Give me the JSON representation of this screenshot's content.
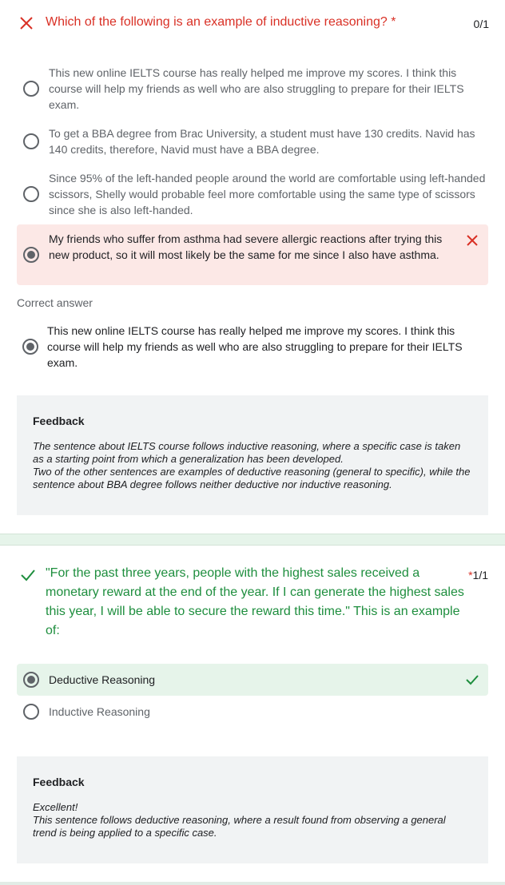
{
  "question1": {
    "title": "Which of the following is an example of inductive reasoning?",
    "required_mark": "*",
    "score": "0/1",
    "options": [
      {
        "text": "This new online IELTS course has really helped me improve my scores. I think this course will help my friends as well who are also struggling to prepare for their IELTS exam.",
        "selected": false
      },
      {
        "text": "To get a BBA degree from Brac University, a student must have 130 credits. Navid has 140 credits, therefore, Navid must have a BBA degree.",
        "selected": false
      },
      {
        "text": "Since 95% of the left-handed people around the world are comfortable using left-handed scissors, Shelly would probable feel more comfortable using the same type of scissors since she is also left-handed.",
        "selected": false
      },
      {
        "text": "My friends who suffer from asthma had severe allergic reactions after trying this new product, so it will most likely be the same for me since I also have asthma.",
        "selected": true,
        "status": "incorrect"
      }
    ],
    "correct_answer_label": "Correct answer",
    "correct_answer": "This new online IELTS course has really helped me improve my scores. I think this course will help my friends as well who are also struggling to prepare for their IELTS exam.",
    "feedback": {
      "title": "Feedback",
      "lines": [
        "The sentence about IELTS course follows inductive reasoning, where a specific case is taken as a starting point from which a generalization has been developed.",
        "Two of the other sentences are examples of deductive reasoning (general to specific), while the sentence about BBA degree follows neither deductive nor inductive reasoning."
      ]
    }
  },
  "question2": {
    "title": "\"For the past three years, people with the highest sales received a monetary reward at the end of the year. If I can generate the highest sales this year, I will be able to secure the reward this time.\" This is an example of:",
    "required_mark": "*",
    "score": "1/1",
    "options": [
      {
        "text": "Deductive Reasoning",
        "selected": true,
        "status": "correct"
      },
      {
        "text": "Inductive Reasoning",
        "selected": false
      }
    ],
    "feedback": {
      "title": "Feedback",
      "lines": [
        "Excellent!",
        "This sentence follows deductive reasoning, where a result found from observing a general trend is being applied to a specific case."
      ]
    }
  },
  "colors": {
    "incorrect": "#d93025",
    "correct": "#1e8e3e",
    "incorrect_bg": "#fce8e6",
    "correct_bg": "#e6f4ea",
    "feedback_bg": "#f1f3f4"
  },
  "icons": {
    "incorrect": "close-x-icon",
    "correct": "check-icon"
  }
}
